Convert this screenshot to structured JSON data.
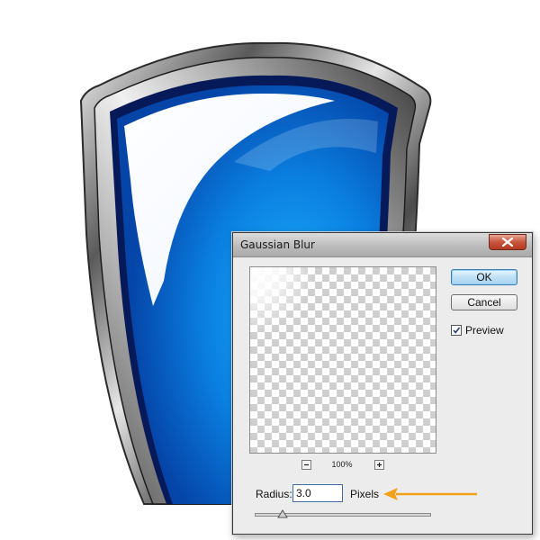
{
  "dialog": {
    "title": "Gaussian Blur",
    "ok_label": "OK",
    "cancel_label": "Cancel",
    "preview_label": "Preview",
    "preview_checked": true,
    "zoom_level": "100%",
    "radius_label": "Radius:",
    "radius_value": "3.0",
    "units_label": "Pixels",
    "slider_position": 0.16
  },
  "icons": {
    "close": "close-icon",
    "zoom_out": "zoom-out-icon",
    "zoom_in": "zoom-in-icon",
    "checkbox": "checkmark-icon",
    "arrow": "arrow-left-icon"
  },
  "colors": {
    "annotation_arrow": "#f3a01a",
    "shield_blue": "#0a7fe0",
    "shield_navy": "#061a5a",
    "ok_border": "#3c7fb1"
  }
}
